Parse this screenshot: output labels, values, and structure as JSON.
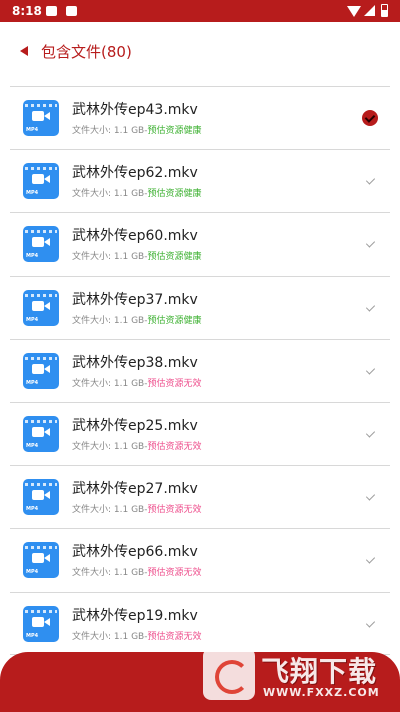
{
  "status_bar": {
    "time": "8:18"
  },
  "header": {
    "title": "包含文件(80)"
  },
  "files": [
    {
      "name": "武林外传ep43.mkv",
      "size": "文件大小: 1.1 GB-",
      "health": "预估资源健康",
      "health_ok": true,
      "checked": true
    },
    {
      "name": "武林外传ep62.mkv",
      "size": "文件大小: 1.1 GB-",
      "health": "预估资源健康",
      "health_ok": true,
      "checked": false
    },
    {
      "name": "武林外传ep60.mkv",
      "size": "文件大小: 1.1 GB-",
      "health": "预估资源健康",
      "health_ok": true,
      "checked": false
    },
    {
      "name": "武林外传ep37.mkv",
      "size": "文件大小: 1.1 GB-",
      "health": "预估资源健康",
      "health_ok": true,
      "checked": false
    },
    {
      "name": "武林外传ep38.mkv",
      "size": "文件大小: 1.1 GB-",
      "health": "预估资源无效",
      "health_ok": false,
      "checked": false
    },
    {
      "name": "武林外传ep25.mkv",
      "size": "文件大小: 1.1 GB-",
      "health": "预估资源无效",
      "health_ok": false,
      "checked": false
    },
    {
      "name": "武林外传ep27.mkv",
      "size": "文件大小: 1.1 GB-",
      "health": "预估资源无效",
      "health_ok": false,
      "checked": false
    },
    {
      "name": "武林外传ep66.mkv",
      "size": "文件大小: 1.1 GB-",
      "health": "预估资源无效",
      "health_ok": false,
      "checked": false
    },
    {
      "name": "武林外传ep19.mkv",
      "size": "文件大小: 1.1 GB-",
      "health": "预估资源无效",
      "health_ok": false,
      "checked": false
    }
  ],
  "file_icon_label": "MP4",
  "watermark": {
    "name": "飞翔下载",
    "url": "WWW.FXXZ.COM"
  },
  "colors": {
    "accent": "#b71c1c",
    "healthy": "#3cb030",
    "invalid": "#ee4e8c",
    "file_icon": "#2f8ff0"
  }
}
